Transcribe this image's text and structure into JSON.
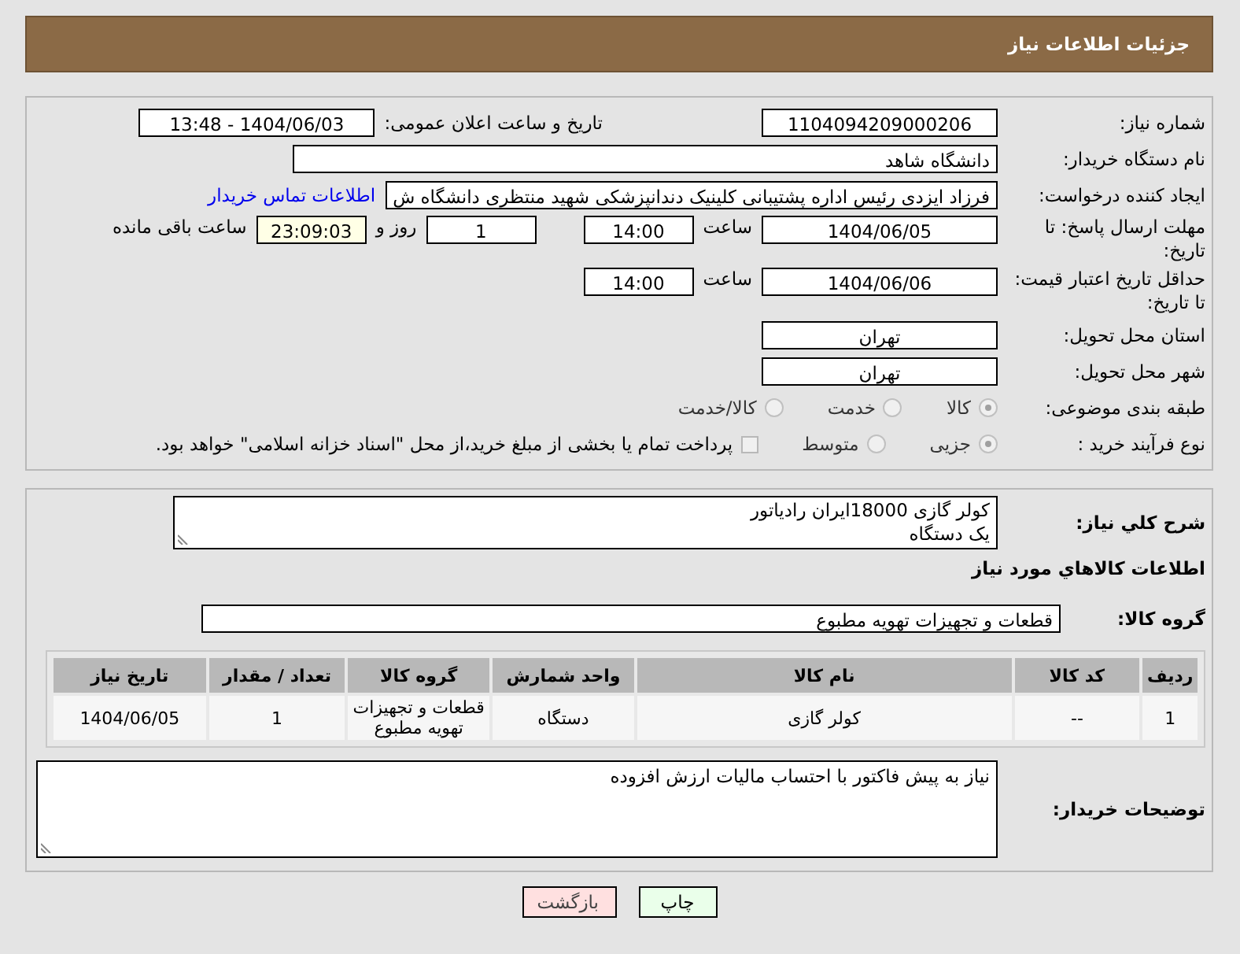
{
  "header": {
    "title": "جزئیات اطلاعات نیاز"
  },
  "details": {
    "need_number": {
      "label": "شماره نیاز:",
      "value": "1104094209000206"
    },
    "announce": {
      "label": "تاریخ و ساعت اعلان عمومی:",
      "value": "1404/06/03 - 13:48"
    },
    "buyer_org": {
      "label": "نام دستگاه خریدار:",
      "value": "دانشگاه شاهد"
    },
    "requester": {
      "label": "ایجاد کننده درخواست:",
      "value": "فرزاد ایزدی رئیس اداره پشتیبانی کلینیک دندانپزشکی شهید منتظری دانشگاه ش",
      "link": "اطلاعات تماس خریدار"
    },
    "deadline": {
      "label": "مهلت ارسال پاسخ: تا تاریخ:",
      "date": "1404/06/05",
      "time_label": "ساعت",
      "time": "14:00",
      "days": "1",
      "days_label": "روز و",
      "remaining": "23:09:03",
      "remaining_label": "ساعت باقی مانده"
    },
    "validity": {
      "label": "حداقل تاریخ اعتبار قیمت: تا تاریخ:",
      "date": "1404/06/06",
      "time_label": "ساعت",
      "time": "14:00"
    },
    "province": {
      "label": "استان محل تحویل:",
      "value": "تهران"
    },
    "city": {
      "label": "شهر محل تحویل:",
      "value": "تهران"
    },
    "category": {
      "label": "طبقه بندی موضوعی:",
      "options": [
        {
          "label": "کالا",
          "selected": true
        },
        {
          "label": "خدمت",
          "selected": false
        },
        {
          "label": "کالا/خدمت",
          "selected": false
        }
      ]
    },
    "process": {
      "label": "نوع فرآیند خرید :",
      "options": [
        {
          "label": "جزیی",
          "selected": true
        },
        {
          "label": "متوسط",
          "selected": false
        }
      ],
      "payment": {
        "checked": false,
        "text": "پرداخت تمام یا بخشی از مبلغ خرید،از محل \"اسناد خزانه اسلامی\" خواهد بود."
      }
    }
  },
  "need": {
    "description_label": "شرح كلي نياز:",
    "description": "کولر گازی 18000ایران رادیاتور\nیک دستگاه",
    "goods_heading": "اطلاعات كالاهاي مورد نياز",
    "group_label": "گروه کالا:",
    "group": "قطعات و تجهیزات تهویه مطبوع",
    "table": {
      "columns": [
        "ردیف",
        "کد کالا",
        "نام کالا",
        "واحد شمارش",
        "گروه کالا",
        "تعداد / مقدار",
        "تاریخ نیاز"
      ],
      "rows": [
        [
          "1",
          "--",
          "کولر گازی",
          "دستگاه",
          "قطعات و تجهیزات تهویه مطبوع",
          "1",
          "1404/06/05"
        ]
      ]
    },
    "notes_label": "توضیحات خریدار:",
    "notes": "نیاز به پیش فاکتور با احتساب مالیات ارزش افزوده"
  },
  "buttons": [
    {
      "label": "چاپ",
      "kind": "print"
    },
    {
      "label": "بازگشت",
      "kind": "back"
    }
  ]
}
